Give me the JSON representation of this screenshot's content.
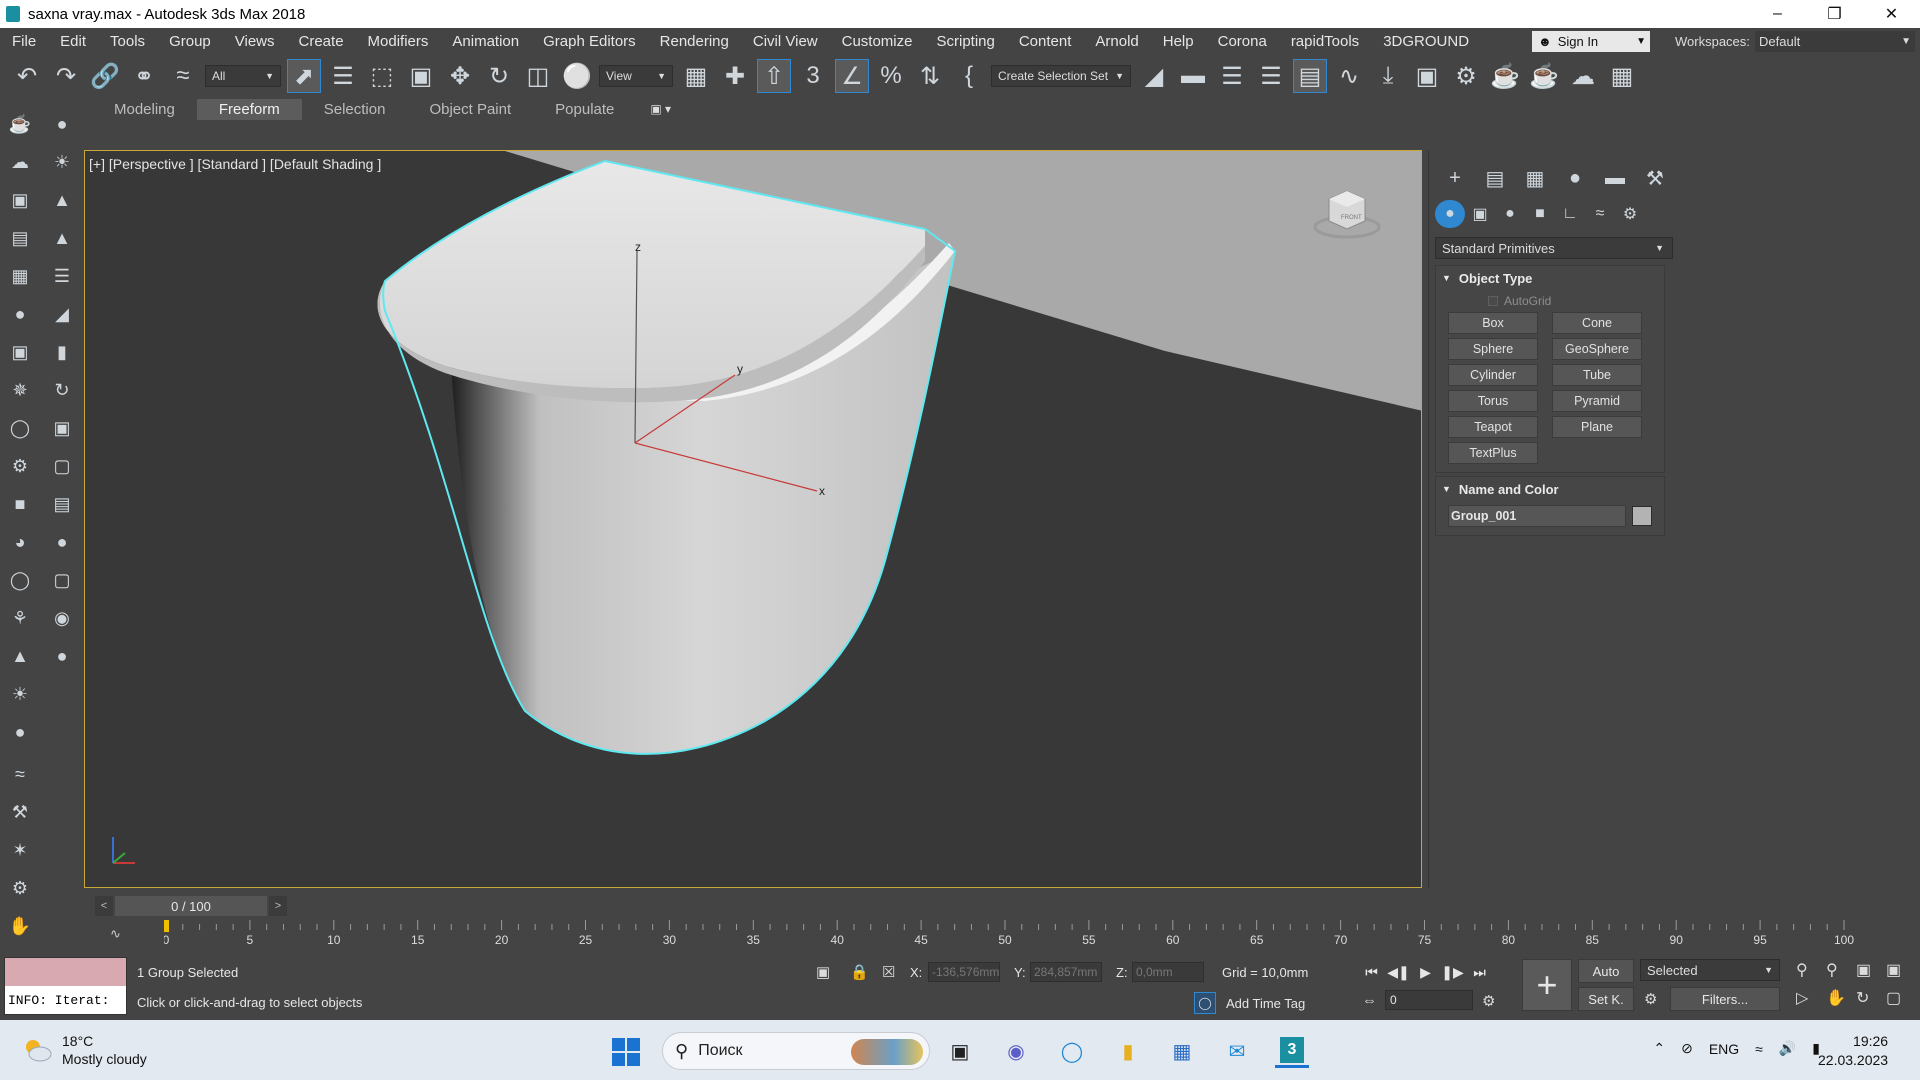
{
  "window": {
    "title": "saxna vray.max - Autodesk 3ds Max 2018",
    "controls": [
      "minimize",
      "restore",
      "close"
    ]
  },
  "menu": {
    "items": [
      "File",
      "Edit",
      "Tools",
      "Group",
      "Views",
      "Create",
      "Modifiers",
      "Animation",
      "Graph Editors",
      "Rendering",
      "Civil View",
      "Customize",
      "Scripting",
      "Content",
      "Arnold",
      "Help",
      "Corona",
      "rapidTools",
      "3DGROUND"
    ],
    "sign_in": "Sign In",
    "workspaces_label": "Workspaces:",
    "workspace_value": "Default"
  },
  "toolbar": {
    "selection_filter": "All",
    "ref_coord": "View",
    "selection_set_placeholder": "Create Selection Set"
  },
  "ribbon": {
    "tabs": [
      "Modeling",
      "Freeform",
      "Selection",
      "Object Paint",
      "Populate"
    ],
    "active_tab": "Freeform"
  },
  "viewport": {
    "label": "[+] [Perspective ] [Standard ] [Default Shading ]",
    "axis_labels": {
      "x": "x",
      "y": "y",
      "z": "z"
    },
    "viewcube_label": "FRONT",
    "selection_highlight_color": "#5fe8f0",
    "active_border_color": "#c9a83a"
  },
  "command_panel": {
    "primitive_type": "Standard Primitives",
    "object_type_title": "Object Type",
    "autogrid_label": "AutoGrid",
    "primitives": [
      "Box",
      "Cone",
      "Sphere",
      "GeoSphere",
      "Cylinder",
      "Tube",
      "Torus",
      "Pyramid",
      "Teapot",
      "Plane",
      "TextPlus"
    ],
    "name_color_title": "Name and Color",
    "object_name": "Group_001",
    "object_color": "#b3b3b3"
  },
  "timeline": {
    "frame_display": "0 / 100",
    "prev_label": "<",
    "next_label": ">",
    "ticks": [
      "0",
      "5",
      "10",
      "15",
      "20",
      "25",
      "30",
      "35",
      "40",
      "45",
      "50",
      "55",
      "60",
      "65",
      "70",
      "75",
      "80",
      "85",
      "90",
      "95",
      "100"
    ]
  },
  "status": {
    "maxscript_output": "INFO: Iterat:",
    "selection_info": "1 Group Selected",
    "prompt": "Click or click-and-drag to select objects",
    "x_label": "X:",
    "x_value": "-136,576mm",
    "y_label": "Y:",
    "y_value": "284,857mm",
    "z_label": "Z:",
    "z_value": "0,0mm",
    "grid": "Grid = 10,0mm",
    "add_time_tag": "Add Time Tag",
    "current_frame": "0",
    "auto_key": "Auto",
    "set_key": "Set K.",
    "key_filter_value": "Selected",
    "filters": "Filters..."
  },
  "taskbar": {
    "weather_temp": "18°C",
    "weather_desc": "Mostly cloudy",
    "search_placeholder": "Поиск",
    "language": "ENG",
    "time": "19:26",
    "date": "22.03.2023"
  }
}
